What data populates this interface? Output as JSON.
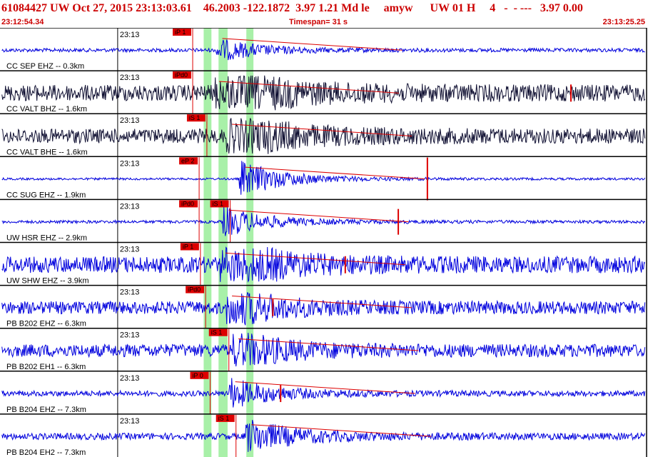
{
  "header": {
    "title_line": "61084427 UW Oct 27, 2015 23:13:03.61    46.2003 -122.1872  3.97 1.21 Md le     amyw      UW 01 H     4   -  - ---   3.97 0.00",
    "start_time": "23:12:54.34",
    "timespan": "Timespan=  31 s",
    "end_time": "23:13:25.25"
  },
  "colors": {
    "title_red": "#cc0000",
    "trace_blue": "#0000dd",
    "trace_dark": "#111133",
    "pick_red": "#dd0000",
    "window_green": "#a8f0a8",
    "grid_black": "#000000"
  },
  "panels": [
    {
      "label": "CC SEP EHZ -- 0.3km",
      "tick": "23:13",
      "picks": [
        {
          "text": "iP 1",
          "pos": 0.298
        }
      ],
      "amp": 0.1,
      "color": "blue",
      "onset": 0.335,
      "burst": 6,
      "post": 0.05,
      "spikes": []
    },
    {
      "label": "CC VALT BHZ -- 1.6km",
      "tick": "23:13",
      "picks": [
        {
          "text": "iPd0",
          "pos": 0.298
        }
      ],
      "amp": 0.45,
      "color": "dark",
      "onset": 0.33,
      "burst": 4,
      "post": 0.5,
      "spikes": [
        {
          "pos": 0.883,
          "h": 12
        }
      ]
    },
    {
      "label": "CC VALT BHE -- 1.6km",
      "tick": "23:13",
      "picks": [
        {
          "text": "iS 1",
          "pos": 0.32
        }
      ],
      "amp": 0.4,
      "color": "dark",
      "onset": 0.35,
      "burst": 3.5,
      "post": 0.45,
      "spikes": []
    },
    {
      "label": "CC SUG EHZ -- 1.9km",
      "tick": "23:13",
      "picks": [
        {
          "text": "eP 2",
          "pos": 0.308
        }
      ],
      "amp": 0.06,
      "color": "blue",
      "onset": 0.37,
      "burst": 10,
      "post": 0.1,
      "spikes": [
        {
          "pos": 0.661,
          "h": 30
        }
      ]
    },
    {
      "label": "UW HSR EHZ -- 2.9km",
      "tick": "23:13",
      "picks": [
        {
          "text": "iPd0",
          "pos": 0.308
        },
        {
          "text": "iS 1",
          "pos": 0.356
        }
      ],
      "amp": 0.08,
      "color": "blue",
      "onset": 0.345,
      "burst": 8,
      "post": 0.1,
      "spikes": [
        {
          "pos": 0.616,
          "h": 18
        }
      ]
    },
    {
      "label": "UW SHW EHZ -- 3.9km",
      "tick": "23:13",
      "picks": [
        {
          "text": "iP 1",
          "pos": 0.31
        }
      ],
      "amp": 0.45,
      "color": "blue",
      "onset": 0.34,
      "burst": 3.5,
      "post": 0.3,
      "spikes": [
        {
          "pos": 0.534,
          "h": 12
        }
      ]
    },
    {
      "label": "PB B202 EHZ -- 6.3km",
      "tick": "23:13",
      "picks": [
        {
          "text": "iPd0",
          "pos": 0.318
        }
      ],
      "amp": 0.35,
      "color": "blue",
      "onset": 0.35,
      "burst": 3,
      "post": 0.2,
      "spikes": [
        {
          "pos": 0.422,
          "h": 12
        }
      ]
    },
    {
      "label": "PB B202 EH1 -- 6.3km",
      "tick": "23:13",
      "picks": [
        {
          "text": "iS 1",
          "pos": 0.354
        }
      ],
      "amp": 0.35,
      "color": "blue",
      "onset": 0.36,
      "burst": 3,
      "post": 0.15,
      "spikes": []
    },
    {
      "label": "PB B204 EHZ -- 7.3km",
      "tick": "23:13",
      "picks": [
        {
          "text": "iP 0",
          "pos": 0.325
        }
      ],
      "amp": 0.15,
      "color": "blue",
      "onset": 0.355,
      "burst": 5,
      "post": 0.1,
      "spikes": [
        {
          "pos": 0.434,
          "h": 12
        }
      ]
    },
    {
      "label": "PB B204 EH2 -- 7.3km",
      "tick": "23:13",
      "picks": [
        {
          "text": "iS 1",
          "pos": 0.365
        }
      ],
      "amp": 0.18,
      "color": "blue",
      "onset": 0.38,
      "burst": 5,
      "post": 0.2,
      "spikes": []
    }
  ],
  "windows": [
    {
      "from": 0.315,
      "to": 0.327
    },
    {
      "from": 0.338,
      "to": 0.352
    },
    {
      "from": 0.381,
      "to": 0.392
    }
  ]
}
